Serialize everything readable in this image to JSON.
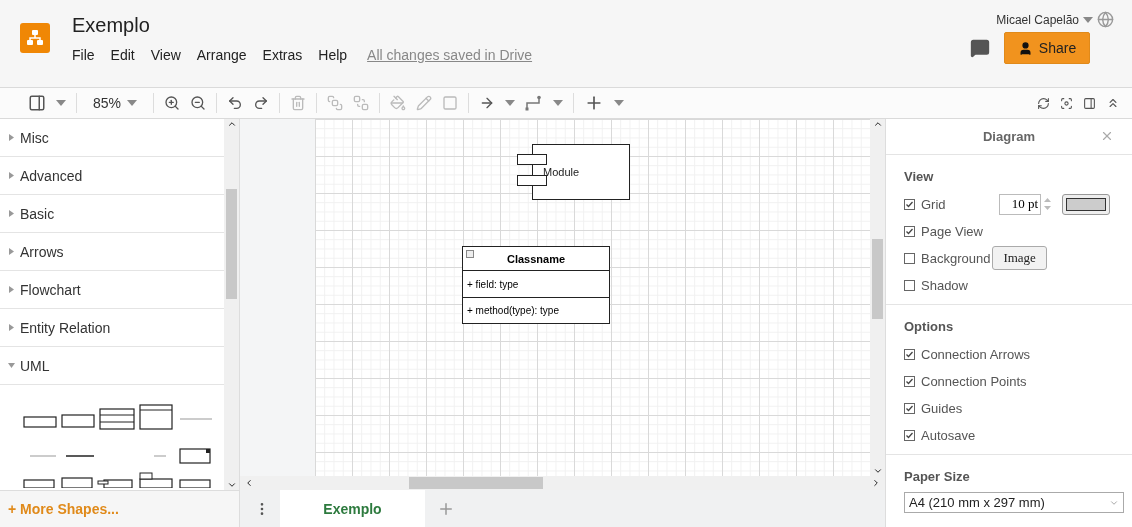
{
  "header": {
    "title": "Exemplo",
    "menus": [
      "File",
      "Edit",
      "View",
      "Arrange",
      "Extras",
      "Help"
    ],
    "save_status": "All changes saved in Drive",
    "user": "Micael Capelão",
    "share_label": "Share"
  },
  "toolbar": {
    "zoom": "85%"
  },
  "sidebar": {
    "sections": [
      {
        "label": "Misc",
        "expanded": false
      },
      {
        "label": "Advanced",
        "expanded": false
      },
      {
        "label": "Basic",
        "expanded": false
      },
      {
        "label": "Arrows",
        "expanded": false
      },
      {
        "label": "Flowchart",
        "expanded": false
      },
      {
        "label": "Entity Relation",
        "expanded": false
      },
      {
        "label": "UML",
        "expanded": true
      }
    ],
    "more_shapes": "+ More Shapes..."
  },
  "canvas": {
    "shapes": [
      {
        "kind": "module",
        "label": "Module"
      },
      {
        "kind": "class",
        "name": "Classname",
        "field": "+ field: type",
        "method": "+ method(type): type"
      }
    ]
  },
  "pages": [
    {
      "label": "Exemplo",
      "selected": true
    }
  ],
  "panel": {
    "title": "Diagram",
    "view": {
      "heading": "View",
      "items": [
        {
          "kind": "grid",
          "label": "Grid",
          "checked": true,
          "value": "10 pt"
        },
        {
          "kind": "plain",
          "label": "Page View",
          "checked": true
        },
        {
          "kind": "image",
          "label": "Background",
          "checked": false,
          "button": "Image"
        },
        {
          "kind": "plain",
          "label": "Shadow",
          "checked": false
        }
      ]
    },
    "options": {
      "heading": "Options",
      "items": [
        {
          "label": "Connection Arrows",
          "checked": true
        },
        {
          "label": "Connection Points",
          "checked": true
        },
        {
          "label": "Guides",
          "checked": true
        },
        {
          "label": "Autosave",
          "checked": true
        }
      ]
    },
    "paper_size": {
      "heading": "Paper Size",
      "value": "A4 (210 mm x 297 mm)"
    }
  }
}
